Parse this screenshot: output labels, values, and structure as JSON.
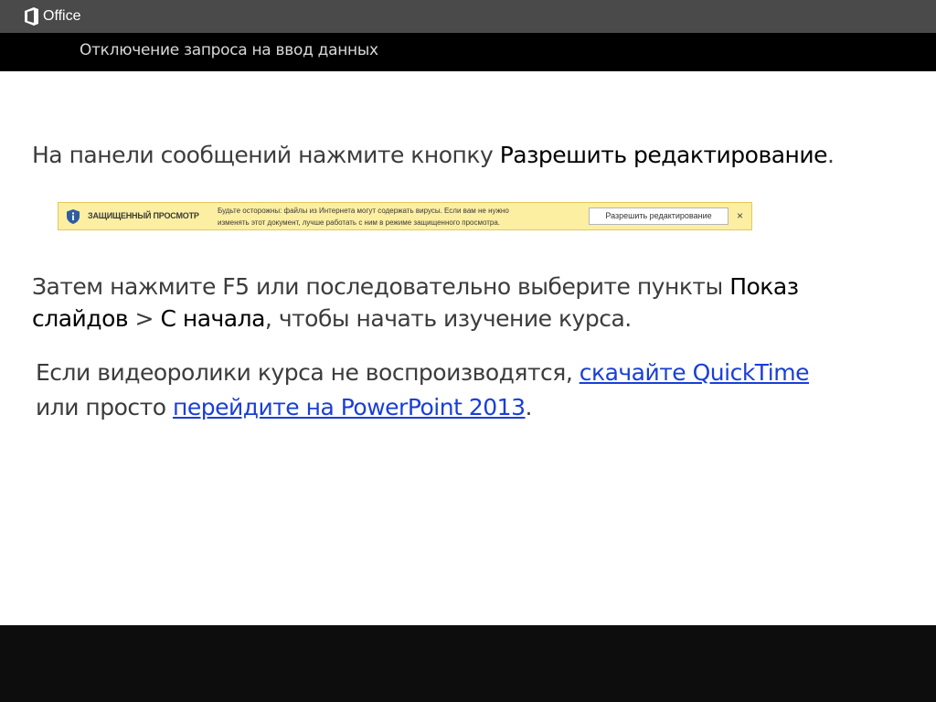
{
  "office_bar": {
    "logo_text": "Office",
    "logo_icon": "office-logo-icon"
  },
  "header": {
    "title": "Отключение запроса на ввод данных"
  },
  "instructions": {
    "line1_prefix": "На панели сообщений нажмите кнопку ",
    "line1_emphasis": "Разрешить редактирование",
    "line1_suffix": ".",
    "line2_prefix": "Затем нажмите F5 или последовательно выберите пункты ",
    "line2_emphasis1": "Показ слайдов",
    "line2_sep": " > ",
    "line2_emphasis2": "С начала",
    "line2_suffix": ", чтобы начать изучение курса.",
    "line3_prefix": "Если видеоролики курса не воспроизводятся, ",
    "line3_link1": "скачайте QuickTime",
    "line3_middle": " или просто ",
    "line3_link2": "перейдите на PowerPoint 2013",
    "line3_suffix": "."
  },
  "message_bar": {
    "icon": "shield-icon",
    "title": "ЗАЩИЩЕННЫЙ ПРОСМОТР",
    "text_line1": "Будьте осторожны: файлы из Интернета могут содержать вирусы. Если вам не нужно",
    "text_line2": "изменять этот документ, лучше работать с ним в режиме защищенного просмотра.",
    "button_label": "Разрешить редактирование",
    "close_label": "×",
    "background_color": "#fcefa1"
  },
  "colors": {
    "office_bar": "#4a4a4a",
    "title_strip": "#000000",
    "link": "#1a3ed8",
    "bottom_bar": "#0d0d0d"
  }
}
